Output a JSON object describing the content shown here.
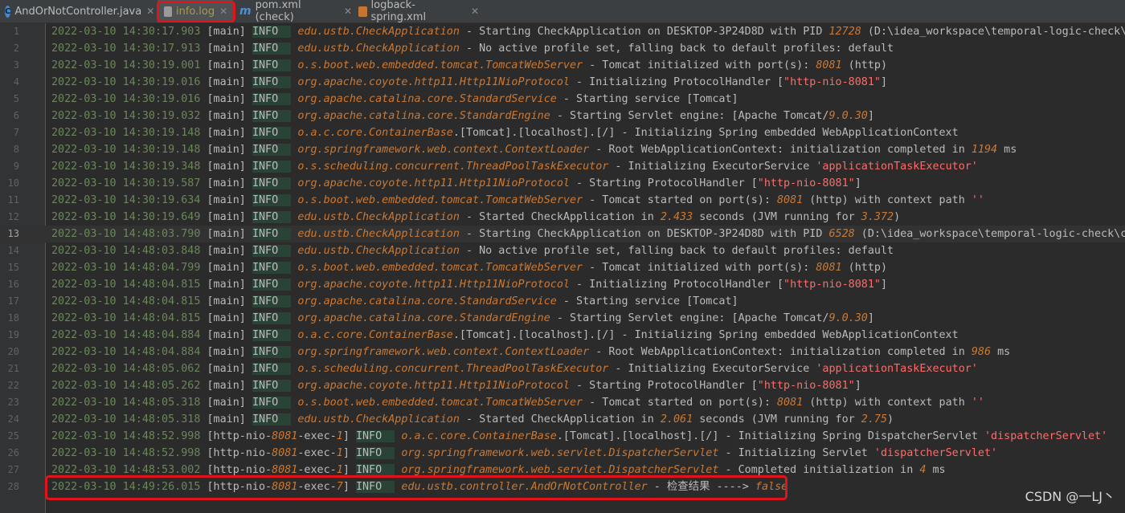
{
  "tabs": [
    {
      "label": "AndOrNotController.java",
      "icon": "class-icon",
      "active": false
    },
    {
      "label": "info.log",
      "icon": "log-file-icon",
      "active": true
    },
    {
      "label": "pom.xml (check)",
      "icon": "maven-icon",
      "active": false
    },
    {
      "label": "logback-spring.xml",
      "icon": "xml-file-icon",
      "active": false
    }
  ],
  "colors": {
    "timestamp": "#6a8759",
    "logger": "#cc7832",
    "number": "#cc7832",
    "string": "#ff6b68",
    "highlight_box": "#e0141a",
    "level_bg": "#294436"
  },
  "current_line": 13,
  "lines": [
    {
      "n": "1",
      "ts": "2022-03-10 14:30:17.903",
      "th": "[main]",
      "lvl": "INFO",
      "lg": "edu.ustb.CheckApplication",
      "msg": [
        [
          "t",
          " - Starting CheckApplication on DESKTOP-3P24D8D with PID "
        ],
        [
          "n",
          "12728"
        ],
        [
          "t",
          " (D:\\idea_workspace\\temporal-logic-check\\che"
        ]
      ]
    },
    {
      "n": "2",
      "ts": "2022-03-10 14:30:17.913",
      "th": "[main]",
      "lvl": "INFO",
      "lg": "edu.ustb.CheckApplication",
      "msg": [
        [
          "t",
          " - No active profile set, falling back to default profiles: default"
        ]
      ]
    },
    {
      "n": "3",
      "ts": "2022-03-10 14:30:19.001",
      "th": "[main]",
      "lvl": "INFO",
      "lg": "o.s.boot.web.embedded.tomcat.TomcatWebServer",
      "msg": [
        [
          "t",
          " - Tomcat initialized with port(s): "
        ],
        [
          "n",
          "8081"
        ],
        [
          "t",
          " (http)"
        ]
      ]
    },
    {
      "n": "4",
      "ts": "2022-03-10 14:30:19.016",
      "th": "[main]",
      "lvl": "INFO",
      "lg": "org.apache.coyote.http11.Http11NioProtocol",
      "msg": [
        [
          "t",
          " - Initializing ProtocolHandler ["
        ],
        [
          "s",
          "\"http-nio-8081\""
        ],
        [
          "t",
          "]"
        ]
      ]
    },
    {
      "n": "5",
      "ts": "2022-03-10 14:30:19.016",
      "th": "[main]",
      "lvl": "INFO",
      "lg": "org.apache.catalina.core.StandardService",
      "msg": [
        [
          "t",
          " - Starting service [Tomcat]"
        ]
      ]
    },
    {
      "n": "6",
      "ts": "2022-03-10 14:30:19.032",
      "th": "[main]",
      "lvl": "INFO",
      "lg": "org.apache.catalina.core.StandardEngine",
      "msg": [
        [
          "t",
          " - Starting Servlet engine: [Apache Tomcat/"
        ],
        [
          "n",
          "9.0.30"
        ],
        [
          "t",
          "]"
        ]
      ]
    },
    {
      "n": "7",
      "ts": "2022-03-10 14:30:19.148",
      "th": "[main]",
      "lvl": "INFO",
      "lg": "o.a.c.core.ContainerBase",
      "msg": [
        [
          "t",
          ".[Tomcat].[localhost].[/] - Initializing Spring embedded WebApplicationContext"
        ]
      ]
    },
    {
      "n": "8",
      "ts": "2022-03-10 14:30:19.148",
      "th": "[main]",
      "lvl": "INFO",
      "lg": "org.springframework.web.context.ContextLoader",
      "msg": [
        [
          "t",
          " - Root WebApplicationContext: initialization completed in "
        ],
        [
          "n",
          "1194"
        ],
        [
          "t",
          " ms"
        ]
      ]
    },
    {
      "n": "9",
      "ts": "2022-03-10 14:30:19.348",
      "th": "[main]",
      "lvl": "INFO",
      "lg": "o.s.scheduling.concurrent.ThreadPoolTaskExecutor",
      "msg": [
        [
          "t",
          " - Initializing ExecutorService "
        ],
        [
          "s",
          "'applicationTaskExecutor'"
        ]
      ]
    },
    {
      "n": "10",
      "ts": "2022-03-10 14:30:19.587",
      "th": "[main]",
      "lvl": "INFO",
      "lg": "org.apache.coyote.http11.Http11NioProtocol",
      "msg": [
        [
          "t",
          " - Starting ProtocolHandler ["
        ],
        [
          "s",
          "\"http-nio-8081\""
        ],
        [
          "t",
          "]"
        ]
      ]
    },
    {
      "n": "11",
      "ts": "2022-03-10 14:30:19.634",
      "th": "[main]",
      "lvl": "INFO",
      "lg": "o.s.boot.web.embedded.tomcat.TomcatWebServer",
      "msg": [
        [
          "t",
          " - Tomcat started on port(s): "
        ],
        [
          "n",
          "8081"
        ],
        [
          "t",
          " (http) with context path "
        ],
        [
          "s",
          "''"
        ]
      ]
    },
    {
      "n": "12",
      "ts": "2022-03-10 14:30:19.649",
      "th": "[main]",
      "lvl": "INFO",
      "lg": "edu.ustb.CheckApplication",
      "msg": [
        [
          "t",
          " - Started CheckApplication in "
        ],
        [
          "n",
          "2.433"
        ],
        [
          "t",
          " seconds (JVM running for "
        ],
        [
          "n",
          "3.372"
        ],
        [
          "t",
          ")"
        ]
      ]
    },
    {
      "n": "13",
      "ts": "2022-03-10 14:48:03.790",
      "th": "[main]",
      "lvl": "INFO",
      "lg": "edu.ustb.CheckApplication",
      "msg": [
        [
          "t",
          " - Starting CheckApplication on DESKTOP-3P24D8D with PID "
        ],
        [
          "n",
          "6528"
        ],
        [
          "t",
          " (D:\\idea_workspace\\temporal-logic-check\\che"
        ]
      ]
    },
    {
      "n": "14",
      "ts": "2022-03-10 14:48:03.848",
      "th": "[main]",
      "lvl": "INFO",
      "lg": "edu.ustb.CheckApplication",
      "msg": [
        [
          "t",
          " - No active profile set, falling back to default profiles: default"
        ]
      ]
    },
    {
      "n": "15",
      "ts": "2022-03-10 14:48:04.799",
      "th": "[main]",
      "lvl": "INFO",
      "lg": "o.s.boot.web.embedded.tomcat.TomcatWebServer",
      "msg": [
        [
          "t",
          " - Tomcat initialized with port(s): "
        ],
        [
          "n",
          "8081"
        ],
        [
          "t",
          " (http)"
        ]
      ]
    },
    {
      "n": "16",
      "ts": "2022-03-10 14:48:04.815",
      "th": "[main]",
      "lvl": "INFO",
      "lg": "org.apache.coyote.http11.Http11NioProtocol",
      "msg": [
        [
          "t",
          " - Initializing ProtocolHandler ["
        ],
        [
          "s",
          "\"http-nio-8081\""
        ],
        [
          "t",
          "]"
        ]
      ]
    },
    {
      "n": "17",
      "ts": "2022-03-10 14:48:04.815",
      "th": "[main]",
      "lvl": "INFO",
      "lg": "org.apache.catalina.core.StandardService",
      "msg": [
        [
          "t",
          " - Starting service [Tomcat]"
        ]
      ]
    },
    {
      "n": "18",
      "ts": "2022-03-10 14:48:04.815",
      "th": "[main]",
      "lvl": "INFO",
      "lg": "org.apache.catalina.core.StandardEngine",
      "msg": [
        [
          "t",
          " - Starting Servlet engine: [Apache Tomcat/"
        ],
        [
          "n",
          "9.0.30"
        ],
        [
          "t",
          "]"
        ]
      ]
    },
    {
      "n": "19",
      "ts": "2022-03-10 14:48:04.884",
      "th": "[main]",
      "lvl": "INFO",
      "lg": "o.a.c.core.ContainerBase",
      "msg": [
        [
          "t",
          ".[Tomcat].[localhost].[/] - Initializing Spring embedded WebApplicationContext"
        ]
      ]
    },
    {
      "n": "20",
      "ts": "2022-03-10 14:48:04.884",
      "th": "[main]",
      "lvl": "INFO",
      "lg": "org.springframework.web.context.ContextLoader",
      "msg": [
        [
          "t",
          " - Root WebApplicationContext: initialization completed in "
        ],
        [
          "n",
          "986"
        ],
        [
          "t",
          " ms"
        ]
      ]
    },
    {
      "n": "21",
      "ts": "2022-03-10 14:48:05.062",
      "th": "[main]",
      "lvl": "INFO",
      "lg": "o.s.scheduling.concurrent.ThreadPoolTaskExecutor",
      "msg": [
        [
          "t",
          " - Initializing ExecutorService "
        ],
        [
          "s",
          "'applicationTaskExecutor'"
        ]
      ]
    },
    {
      "n": "22",
      "ts": "2022-03-10 14:48:05.262",
      "th": "[main]",
      "lvl": "INFO",
      "lg": "org.apache.coyote.http11.Http11NioProtocol",
      "msg": [
        [
          "t",
          " - Starting ProtocolHandler ["
        ],
        [
          "s",
          "\"http-nio-8081\""
        ],
        [
          "t",
          "]"
        ]
      ]
    },
    {
      "n": "23",
      "ts": "2022-03-10 14:48:05.318",
      "th": "[main]",
      "lvl": "INFO",
      "lg": "o.s.boot.web.embedded.tomcat.TomcatWebServer",
      "msg": [
        [
          "t",
          " - Tomcat started on port(s): "
        ],
        [
          "n",
          "8081"
        ],
        [
          "t",
          " (http) with context path "
        ],
        [
          "s",
          "''"
        ]
      ]
    },
    {
      "n": "24",
      "ts": "2022-03-10 14:48:05.318",
      "th": "[main]",
      "lvl": "INFO",
      "lg": "edu.ustb.CheckApplication",
      "msg": [
        [
          "t",
          " - Started CheckApplication in "
        ],
        [
          "n",
          "2.061"
        ],
        [
          "t",
          " seconds (JVM running for "
        ],
        [
          "n",
          "2.75"
        ],
        [
          "t",
          ")"
        ]
      ]
    },
    {
      "n": "25",
      "ts": "2022-03-10 14:48:52.998",
      "th": [
        [
          "t",
          "[http-nio-"
        ],
        [
          "n",
          "8081"
        ],
        [
          "t",
          "-exec-"
        ],
        [
          "n",
          "1"
        ],
        [
          "t",
          "]"
        ]
      ],
      "lvl": "INFO",
      "lg": "o.a.c.core.ContainerBase",
      "msg": [
        [
          "t",
          ".[Tomcat].[localhost].[/] - Initializing Spring DispatcherServlet "
        ],
        [
          "s",
          "'dispatcherServlet'"
        ]
      ]
    },
    {
      "n": "26",
      "ts": "2022-03-10 14:48:52.998",
      "th": [
        [
          "t",
          "[http-nio-"
        ],
        [
          "n",
          "8081"
        ],
        [
          "t",
          "-exec-"
        ],
        [
          "n",
          "1"
        ],
        [
          "t",
          "]"
        ]
      ],
      "lvl": "INFO",
      "lg": "org.springframework.web.servlet.DispatcherServlet",
      "msg": [
        [
          "t",
          " - Initializing Servlet "
        ],
        [
          "s",
          "'dispatcherServlet'"
        ]
      ]
    },
    {
      "n": "27",
      "ts": "2022-03-10 14:48:53.002",
      "th": [
        [
          "t",
          "[http-nio-"
        ],
        [
          "n",
          "8081"
        ],
        [
          "t",
          "-exec-"
        ],
        [
          "n",
          "1"
        ],
        [
          "t",
          "]"
        ]
      ],
      "lvl": "INFO",
      "lg": "org.springframework.web.servlet.DispatcherServlet",
      "msg": [
        [
          "t",
          " - Completed initialization in "
        ],
        [
          "n",
          "4"
        ],
        [
          "t",
          " ms"
        ]
      ]
    },
    {
      "n": "28",
      "ts": "2022-03-10 14:49:26.015",
      "th": [
        [
          "t",
          "[http-nio-"
        ],
        [
          "n",
          "8081"
        ],
        [
          "t",
          "-exec-"
        ],
        [
          "n",
          "7"
        ],
        [
          "t",
          "]"
        ]
      ],
      "lvl": "INFO",
      "lg": "edu.ustb.controller.AndOrNotController",
      "msg": [
        [
          "t",
          " - 检查结果 ----> "
        ],
        [
          "k",
          "false"
        ]
      ]
    }
  ],
  "watermark": "CSDN @一LJ丶"
}
